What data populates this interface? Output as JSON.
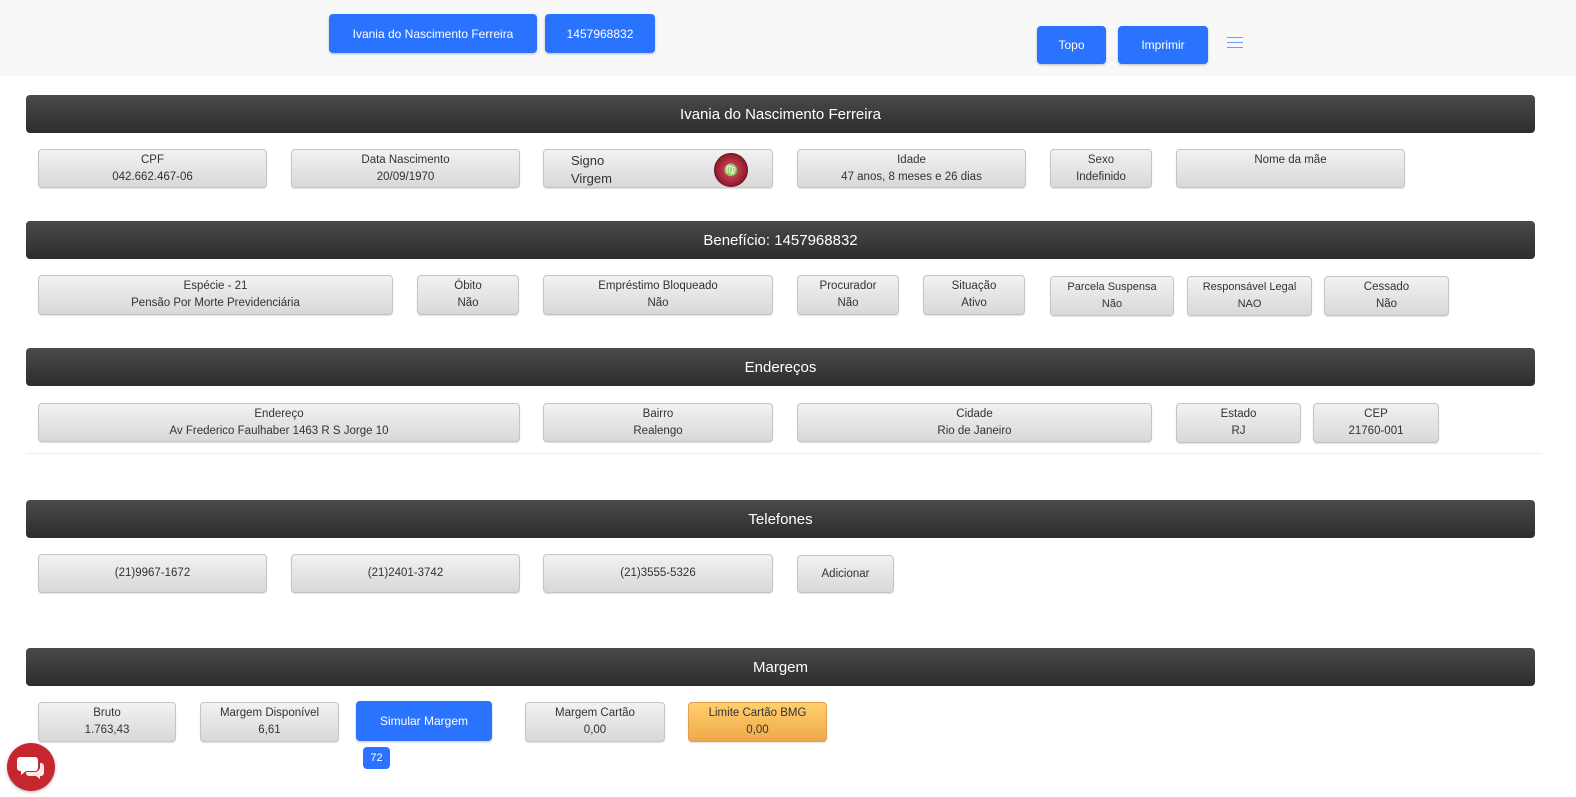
{
  "topbar": {
    "name_button": "Ivania do Nascimento Ferreira",
    "beneficio_button": "1457968832",
    "topo_button": "Topo",
    "imprimir_button": "Imprimir",
    "menu_icon": "hamburger-icon"
  },
  "pessoal": {
    "header": "Ivania do Nascimento Ferreira",
    "cpf": {
      "label": "CPF",
      "value": "042.662.467-06"
    },
    "nascimento": {
      "label": "Data Nascimento",
      "value": "20/09/1970"
    },
    "signo": {
      "label": "Signo",
      "value": "Virgem",
      "icon": "virgo-zodiac-icon"
    },
    "idade": {
      "label": "Idade",
      "value": "47 anos, 8 meses e 26 dias"
    },
    "sexo": {
      "label": "Sexo",
      "value": "Indefinido"
    },
    "mae": {
      "label": "Nome da mãe",
      "value": ""
    }
  },
  "beneficio": {
    "header": "Benefício: 1457968832",
    "especie": {
      "label": "Espécie - 21",
      "value": "Pensão Por Morte Previdenciária"
    },
    "obito": {
      "label": "Óbito",
      "value": "Não"
    },
    "emprestimo": {
      "label": "Empréstimo Bloqueado",
      "value": "Não"
    },
    "procurador": {
      "label": "Procurador",
      "value": "Não"
    },
    "situacao": {
      "label": "Situação",
      "value": "Ativo"
    },
    "parcela": {
      "label": "Parcela Suspensa",
      "value": "Não"
    },
    "responsavel": {
      "label": "Responsável Legal",
      "value": "NAO"
    },
    "cessado": {
      "label": "Cessado",
      "value": "Não"
    }
  },
  "enderecos": {
    "header": "Endereços",
    "endereco": {
      "label": "Endereço",
      "value": "Av Frederico Faulhaber 1463 R S Jorge 10"
    },
    "bairro": {
      "label": "Bairro",
      "value": "Realengo"
    },
    "cidade": {
      "label": "Cidade",
      "value": "Rio de Janeiro"
    },
    "estado": {
      "label": "Estado",
      "value": "RJ"
    },
    "cep": {
      "label": "CEP",
      "value": "21760-001"
    }
  },
  "telefones": {
    "header": "Telefones",
    "items": [
      "(21)9967-1672",
      "(21)2401-3742",
      "(21)3555-5326"
    ],
    "add_label": "Adicionar"
  },
  "margem": {
    "header": "Margem",
    "bruto": {
      "label": "Bruto",
      "value": "1.763,43"
    },
    "disponivel": {
      "label": "Margem Disponível",
      "value": "6,61"
    },
    "simular_label": "Simular Margem",
    "simular_badge": "72",
    "cartao": {
      "label": "Margem Cartão",
      "value": "0,00"
    },
    "limite_bmg": {
      "label": "Limite Cartão BMG",
      "value": "0,00"
    }
  },
  "chat_icon": "chat-bubbles-icon",
  "colors": {
    "primary": "#2a73ff",
    "header_bg": "#3a3a3a",
    "warning": "#f0a94a",
    "chat": "#c4282e"
  }
}
